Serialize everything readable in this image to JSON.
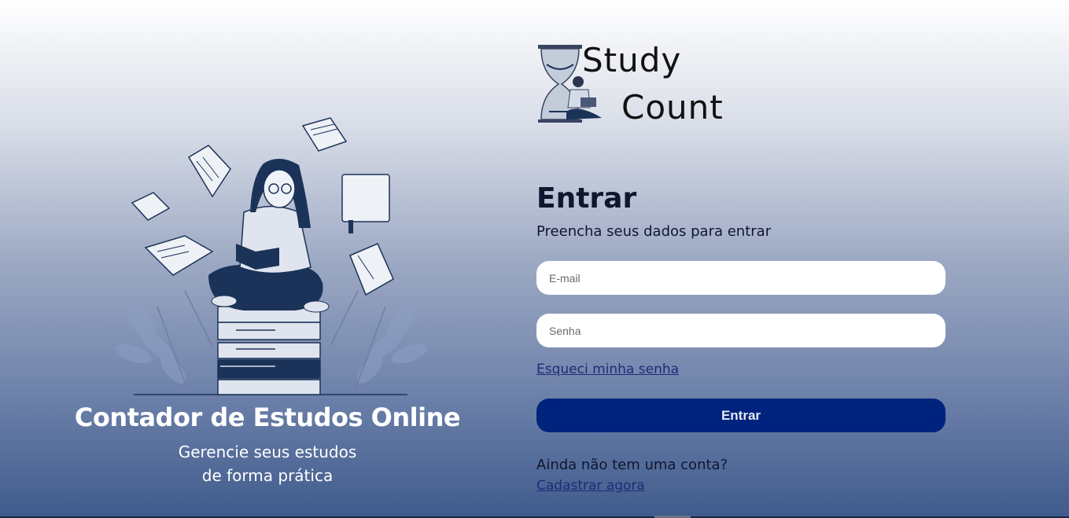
{
  "brand": {
    "logo_line1": "Study",
    "logo_line2": "Count"
  },
  "hero": {
    "title": "Contador de Estudos Online",
    "subtitle_line1": "Gerencie seus estudos",
    "subtitle_line2": "de forma prática"
  },
  "login": {
    "heading": "Entrar",
    "subheading": "Preencha seus dados para entrar",
    "email_placeholder": "E-mail",
    "password_placeholder": "Senha",
    "forgot_link": "Esqueci minha senha",
    "submit_label": "Entrar",
    "signup_question": "Ainda não tem uma conta?",
    "signup_link": "Cadastrar agora"
  },
  "colors": {
    "primary_button": "#00247e",
    "link": "#1f2b78",
    "illustration_navy": "#1b3358"
  }
}
